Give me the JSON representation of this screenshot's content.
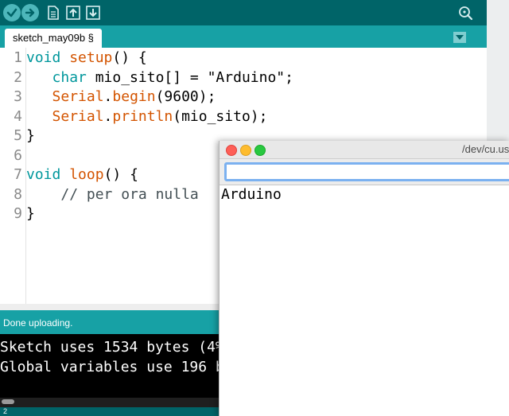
{
  "ide": {
    "toolbar": {
      "buttons": [
        {
          "name": "verify",
          "icon": "checkmark-icon"
        },
        {
          "name": "upload",
          "icon": "arrow-right-icon"
        },
        {
          "name": "new",
          "icon": "document-icon"
        },
        {
          "name": "open",
          "icon": "arrow-up-icon"
        },
        {
          "name": "save",
          "icon": "arrow-down-icon"
        }
      ],
      "serial_monitor_icon": "magnifier-icon"
    },
    "tab": {
      "label": "sketch_may09b §"
    },
    "editor": {
      "line_numbers": [
        "1",
        "2",
        "3",
        "4",
        "5",
        "6",
        "7",
        "8",
        "9"
      ],
      "lines": [
        [
          {
            "t": "void",
            "c": "kw"
          },
          {
            "t": " "
          },
          {
            "t": "setup",
            "c": "fn"
          },
          {
            "t": "() {"
          }
        ],
        [
          {
            "t": "   "
          },
          {
            "t": "char",
            "c": "kw"
          },
          {
            "t": " mio_sito[] = \"Arduino\";"
          }
        ],
        [
          {
            "t": "   "
          },
          {
            "t": "Serial",
            "c": "fn"
          },
          {
            "t": "."
          },
          {
            "t": "begin",
            "c": "fn"
          },
          {
            "t": "(9600);"
          }
        ],
        [
          {
            "t": "   "
          },
          {
            "t": "Serial",
            "c": "fn"
          },
          {
            "t": "."
          },
          {
            "t": "println",
            "c": "fn"
          },
          {
            "t": "(mio_sito);"
          }
        ],
        [
          {
            "t": "}"
          }
        ],
        [
          {
            "t": ""
          }
        ],
        [
          {
            "t": "void",
            "c": "kw"
          },
          {
            "t": " "
          },
          {
            "t": "loop",
            "c": "fn"
          },
          {
            "t": "() {"
          }
        ],
        [
          {
            "t": "    "
          },
          {
            "t": "// per ora nulla",
            "c": "cm"
          }
        ],
        [
          {
            "t": "}"
          }
        ]
      ]
    },
    "status": "Done uploading.",
    "console": [
      "Sketch uses 1534 bytes (4%",
      "Global variables use 196 b"
    ],
    "footer": "2",
    "colors": {
      "dark_teal": "#006468",
      "teal": "#17a1a5",
      "keyword": "#00979c",
      "function": "#d35400"
    }
  },
  "serial_monitor": {
    "title": "/dev/cu.us",
    "input_value": "",
    "output": "Arduino",
    "traffic_lights": {
      "close": "#fe5f57",
      "minimize": "#febc2e",
      "zoom": "#28c840"
    }
  }
}
